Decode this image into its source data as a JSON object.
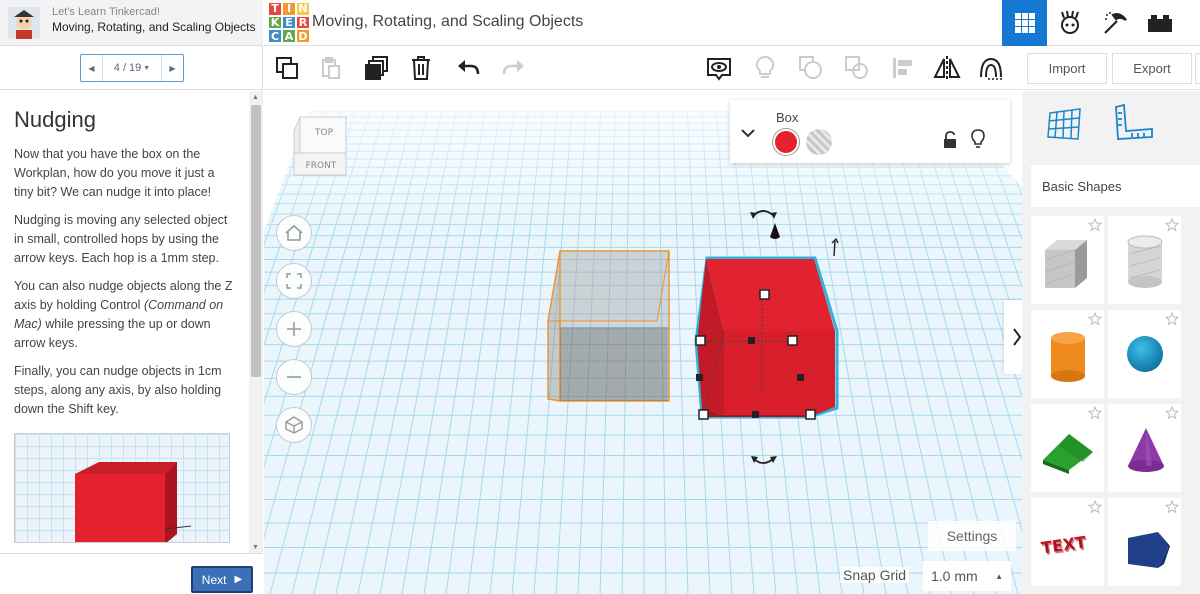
{
  "lesson": {
    "course": "Let's Learn Tinkercad!",
    "title": "Moving, Rotating, and Scaling Objects",
    "pager": "4 / 19",
    "heading": "Nudging",
    "paragraphs": [
      "Now that you have the box on the Workplan, how do you move it just a tiny bit? We can nudge it into place!",
      "Nudging is moving any selected object in small, controlled hops by using the arrow keys. Each hop is a 1mm step."
    ],
    "p3_before": "You can also nudge objects along the Z axis by holding Control ",
    "p3_em": "(Command on Mac)",
    "p3_after": " while pressing the up or down arrow keys.",
    "p4": "Finally, you can nudge objects in 1cm steps, along any axis, by also holding down the Shift key.",
    "next_label": "Next"
  },
  "topbar": {
    "logo_letters": [
      "T",
      "I",
      "N",
      "K",
      "E",
      "R",
      "C",
      "A",
      "D"
    ],
    "logo_colors": [
      "#e8473c",
      "#f29a2e",
      "#f5c94a",
      "#5bab47",
      "#3f8ec8",
      "#e8473c",
      "#3f8ec8",
      "#5bab47",
      "#f29a2e"
    ],
    "doc_title": "Moving, Rotating, and Scaling Objects",
    "modes": [
      "3d-view-icon",
      "simulate-icon",
      "blocks-icon",
      "bricks-icon"
    ],
    "accent": "#1477d2"
  },
  "toolbar": {
    "import_label": "Import",
    "export_label": "Export"
  },
  "viewcube": {
    "top": "TOP",
    "front": "FRONT"
  },
  "inspector": {
    "title": "Box",
    "solid_color": "#e4222f"
  },
  "workplane": {
    "settings_label": "Settings",
    "snap_label": "Snap Grid",
    "snap_value": "1.0 mm",
    "grid_color": "#9fd7ee"
  },
  "shapes": {
    "category": "Basic Shapes",
    "items": [
      "Box",
      "Cylinder (Hole)",
      "Cylinder",
      "Sphere",
      "Roof",
      "Cone",
      "Text",
      "Polygon"
    ]
  }
}
